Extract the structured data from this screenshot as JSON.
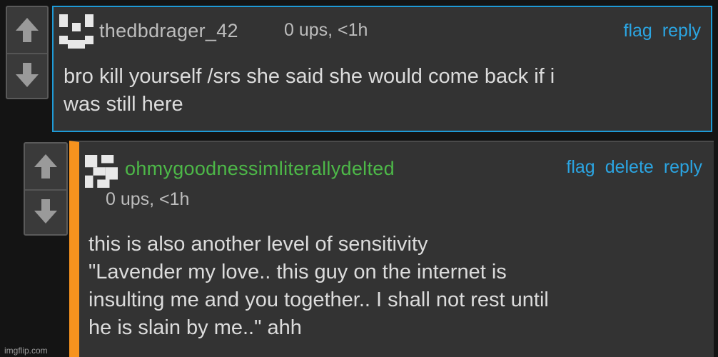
{
  "comments": [
    {
      "username": "thedbdrager_42",
      "meta": "0 ups, <1h",
      "actions": [
        "flag",
        "reply"
      ],
      "body": "bro kill yourself /srs she said she would come back if i\nwas still here"
    },
    {
      "username": "ohmygoodnessimliterallydelted",
      "meta": "0 ups, <1h",
      "actions": [
        "flag",
        "delete",
        "reply"
      ],
      "body": "this is also another level of sensitivity\n\"Lavender my love.. this guy on the internet is\ninsulting me and you together.. I shall not rest until\nhe is slain by me..\" ahh"
    }
  ],
  "colors": {
    "accent_blue": "#2ba5e2",
    "reply_bar": "#f7931e",
    "username_green": "#4db848",
    "username_gray": "#bdbdbd"
  },
  "watermark": "imgflip.com"
}
